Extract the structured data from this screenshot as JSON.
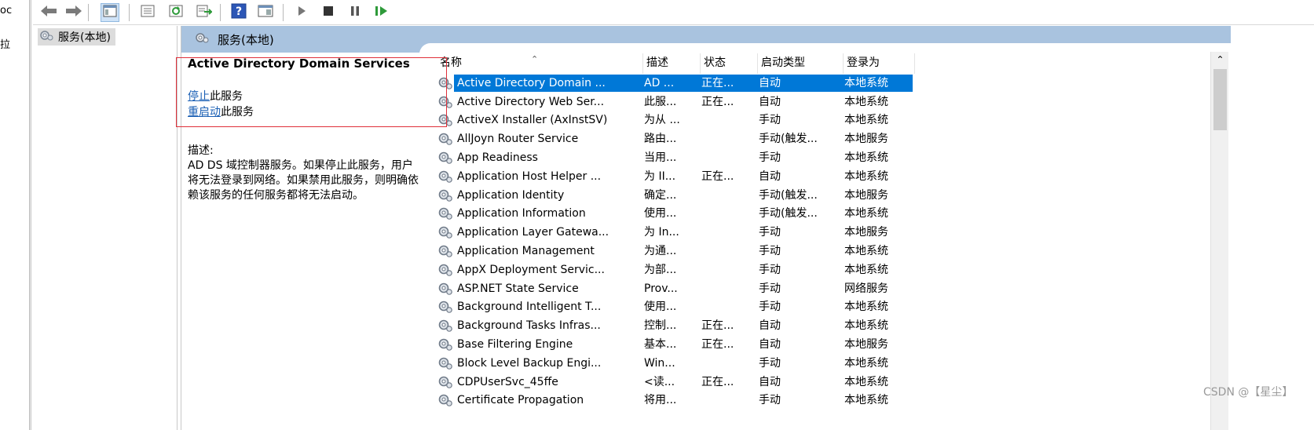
{
  "left_strip": {
    "line1": "oc",
    "line2": "拉"
  },
  "toolbar": {
    "buttons": [
      {
        "icon": "back-arrow-icon"
      },
      {
        "icon": "forward-arrow-icon"
      },
      {
        "icon": "console-tree-icon"
      },
      {
        "icon": "properties-icon"
      },
      {
        "icon": "refresh-icon"
      },
      {
        "icon": "export-list-icon"
      },
      {
        "icon": "help-icon"
      },
      {
        "icon": "show-action-pane-icon"
      },
      {
        "icon": "start-service-icon"
      },
      {
        "icon": "stop-service-icon"
      },
      {
        "icon": "pause-service-icon"
      },
      {
        "icon": "restart-service-icon"
      }
    ]
  },
  "tree": {
    "item_label": "服务(本地)"
  },
  "main": {
    "header_title": "服务(本地)"
  },
  "details": {
    "title": "Active Directory Domain Services",
    "stop_link": "停止",
    "stop_suffix": "此服务",
    "restart_link": "重启动",
    "restart_suffix": "此服务",
    "desc_label": "描述:",
    "desc_text": "AD DS 域控制器服务。如果停止此服务，用户将无法登录到网络。如果禁用此服务，则明确依赖该服务的任何服务都将无法启动。"
  },
  "list": {
    "columns": {
      "name": "名称",
      "description": "描述",
      "status": "状态",
      "startup": "启动类型",
      "logon": "登录为"
    },
    "rows": [
      {
        "name": "Active Directory Domain ...",
        "description": "AD ...",
        "status": "正在...",
        "startup": "自动",
        "logon": "本地系统",
        "selected": true
      },
      {
        "name": "Active Directory Web Ser...",
        "description": "此服...",
        "status": "正在...",
        "startup": "自动",
        "logon": "本地系统"
      },
      {
        "name": "ActiveX Installer (AxInstSV)",
        "description": "为从 ...",
        "status": "",
        "startup": "手动",
        "logon": "本地系统"
      },
      {
        "name": "AllJoyn Router Service",
        "description": "路由...",
        "status": "",
        "startup": "手动(触发...",
        "logon": "本地服务"
      },
      {
        "name": "App Readiness",
        "description": "当用...",
        "status": "",
        "startup": "手动",
        "logon": "本地系统"
      },
      {
        "name": "Application Host Helper ...",
        "description": "为 II...",
        "status": "正在...",
        "startup": "自动",
        "logon": "本地系统"
      },
      {
        "name": "Application Identity",
        "description": "确定...",
        "status": "",
        "startup": "手动(触发...",
        "logon": "本地服务"
      },
      {
        "name": "Application Information",
        "description": "使用...",
        "status": "",
        "startup": "手动(触发...",
        "logon": "本地系统"
      },
      {
        "name": "Application Layer Gatewa...",
        "description": "为 In...",
        "status": "",
        "startup": "手动",
        "logon": "本地服务"
      },
      {
        "name": "Application Management",
        "description": "为通...",
        "status": "",
        "startup": "手动",
        "logon": "本地系统"
      },
      {
        "name": "AppX Deployment Servic...",
        "description": "为部...",
        "status": "",
        "startup": "手动",
        "logon": "本地系统"
      },
      {
        "name": "ASP.NET State Service",
        "description": "Prov...",
        "status": "",
        "startup": "手动",
        "logon": "网络服务"
      },
      {
        "name": "Background Intelligent T...",
        "description": "使用...",
        "status": "",
        "startup": "手动",
        "logon": "本地系统"
      },
      {
        "name": "Background Tasks Infras...",
        "description": "控制...",
        "status": "正在...",
        "startup": "自动",
        "logon": "本地系统"
      },
      {
        "name": "Base Filtering Engine",
        "description": "基本...",
        "status": "正在...",
        "startup": "自动",
        "logon": "本地服务"
      },
      {
        "name": "Block Level Backup Engi...",
        "description": "Win...",
        "status": "",
        "startup": "手动",
        "logon": "本地系统"
      },
      {
        "name": "CDPUserSvc_45ffe",
        "description": "<读...",
        "status": "正在...",
        "startup": "自动",
        "logon": "本地系统"
      },
      {
        "name": "Certificate Propagation",
        "description": "将用...",
        "status": "",
        "startup": "手动",
        "logon": "本地系统"
      }
    ]
  },
  "watermark": "CSDN @【星尘】",
  "colors": {
    "selection": "#0078d7",
    "header_band": "#a9c3df",
    "highlight_box": "#e0303a",
    "link": "#1a5fb4"
  }
}
